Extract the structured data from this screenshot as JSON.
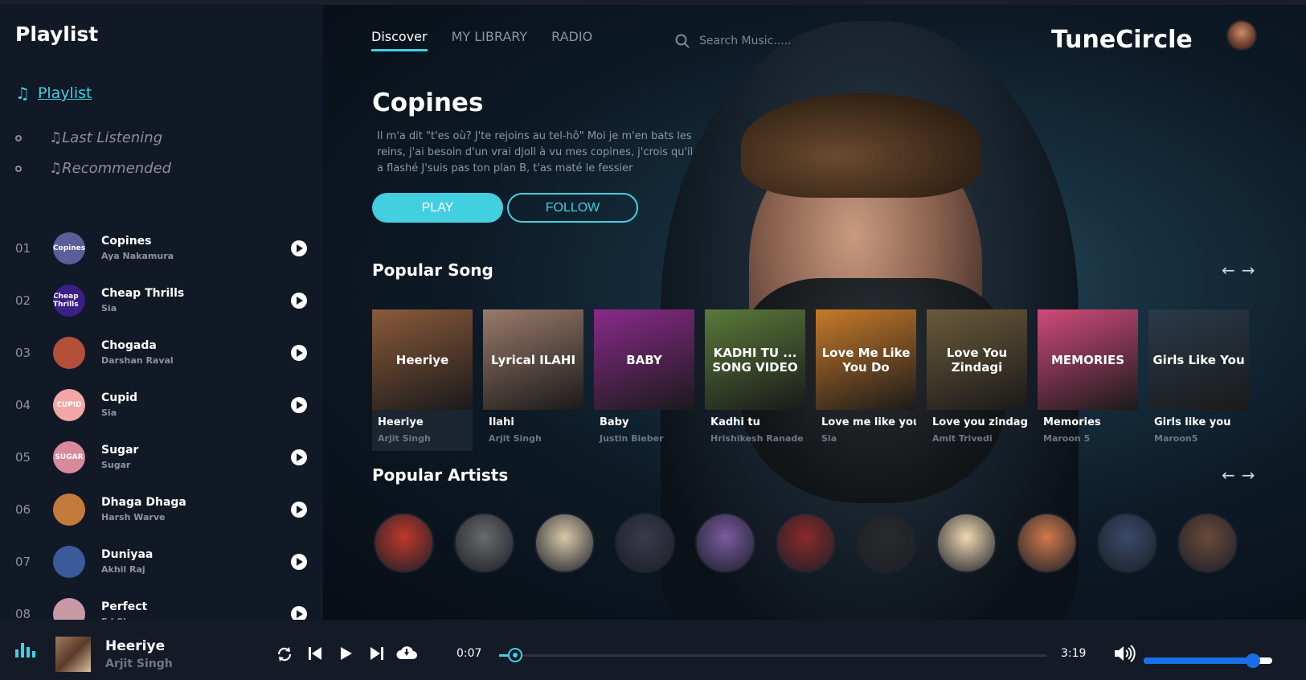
{
  "sidebar": {
    "title": "Playlist",
    "nav_active": "Playlist",
    "nav_items": [
      "♫Last Listening",
      "♫Recommended"
    ],
    "tracks": [
      {
        "num": "01",
        "title": "Copines",
        "artist": "Aya Nakamura",
        "cover_text": "Copines",
        "cover_color": "#5a5f9a"
      },
      {
        "num": "02",
        "title": "Cheap Thrills",
        "artist": "Sia",
        "cover_text": "Cheap Thrills",
        "cover_color": "#3a1f86"
      },
      {
        "num": "03",
        "title": "Chogada",
        "artist": "Darshan Raval",
        "cover_text": "",
        "cover_color": "#b4503a"
      },
      {
        "num": "04",
        "title": "Cupid",
        "artist": "Sia",
        "cover_text": "CUPID",
        "cover_color": "#f2a7a6"
      },
      {
        "num": "05",
        "title": "Sugar",
        "artist": "Sugar",
        "cover_text": "SUGAR",
        "cover_color": "#d98a9a"
      },
      {
        "num": "06",
        "title": "Dhaga Dhaga",
        "artist": "Harsh Warve",
        "cover_text": "",
        "cover_color": "#c47a3a"
      },
      {
        "num": "07",
        "title": "Duniyaa",
        "artist": "Akhil Raj",
        "cover_text": "",
        "cover_color": "#3a5a9a"
      },
      {
        "num": "08",
        "title": "Perfect",
        "artist": "Ed Sheeran",
        "cover_text": "",
        "cover_color": "#c89aa6"
      }
    ]
  },
  "header": {
    "nav": [
      "Discover",
      "MY LIBRARY",
      "RADIO"
    ],
    "search_placeholder": "Search Music.....",
    "brand": "TuneCircle"
  },
  "hero": {
    "title": "Copines",
    "description": "Il m'a dit \"t'es où? J'te rejoins au tel-hô\" Moi je m'en bats les reins, j'ai besoin d'un vrai djoll à vu mes copines, j'crois qu'il a flashé J'suis pas ton plan B, t'as maté le fessier",
    "play_label": "PLAY",
    "follow_label": "FOLLOW"
  },
  "popular_songs": {
    "title": "Popular Song",
    "arrows": [
      "←",
      "→"
    ],
    "items": [
      {
        "title": "Heeriye",
        "artist": "Arjit Singh",
        "img_text": "Heeriye",
        "color": "#8a5a3a"
      },
      {
        "title": "Ilahi",
        "artist": "Arjit Singh",
        "img_text": "Lyrical ILAHI",
        "color": "#9a7a6a"
      },
      {
        "title": "Baby",
        "artist": "Justin Bieber",
        "img_text": "BABY",
        "color": "#8a2a8a"
      },
      {
        "title": "Kadhi tu",
        "artist": "Hrishikesh Ranade",
        "img_text": "KADHI TU ... SONG VIDEO",
        "color": "#5a7a3a"
      },
      {
        "title": "Love me like you ...",
        "artist": "Sia",
        "img_text": "Love Me Like You Do",
        "color": "#c87a2a"
      },
      {
        "title": "Love you zindagi",
        "artist": "Amit Trivedi",
        "img_text": "Love You Zindagi",
        "color": "#6a5a3a"
      },
      {
        "title": "Memories",
        "artist": "Maroon 5",
        "img_text": "MEMORIES",
        "color": "#d04a7a"
      },
      {
        "title": "Girls like you",
        "artist": "Maroon5",
        "img_text": "Girls Like You",
        "color": "#2a3a4a"
      }
    ]
  },
  "popular_artists": {
    "title": "Popular Artists",
    "arrows": [
      "←",
      "→"
    ],
    "items": [
      {
        "name": "artist-1",
        "color": "#c0392b"
      },
      {
        "name": "artist-2",
        "color": "#6a6a6a"
      },
      {
        "name": "artist-3",
        "color": "#d8c8a8"
      },
      {
        "name": "artist-4",
        "color": "#3a3a4a"
      },
      {
        "name": "artist-5",
        "color": "#7a5aa0"
      },
      {
        "name": "artist-6",
        "color": "#8a2a2a"
      },
      {
        "name": "artist-7",
        "color": "#2a2a2a"
      },
      {
        "name": "artist-8",
        "color": "#f0d8b0"
      },
      {
        "name": "artist-9",
        "color": "#d07a4a"
      },
      {
        "name": "artist-10",
        "color": "#3a4a6a"
      },
      {
        "name": "artist-11",
        "color": "#6a4a3a"
      }
    ]
  },
  "player": {
    "title": "Heeriye",
    "artist": "Arjit Singh",
    "current_time": "0:07",
    "total_time": "3:19",
    "progress": 0.03,
    "volume": 0.85
  },
  "colors": {
    "accent": "#3fd1e3",
    "volume_accent": "#1a6fe8"
  }
}
